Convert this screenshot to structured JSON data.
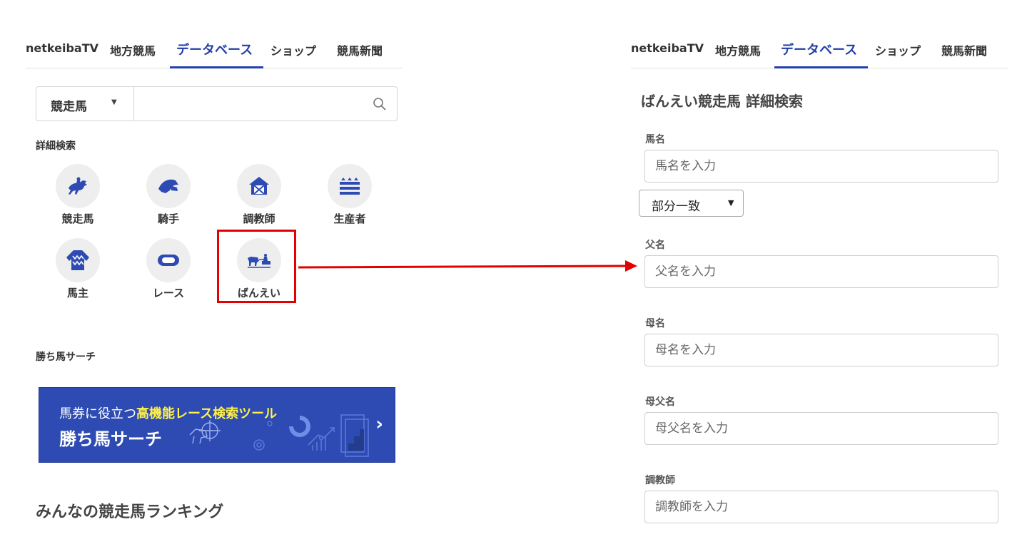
{
  "nav": {
    "tabs": [
      "netkeibaTV",
      "地方競馬",
      "データベース",
      "ショップ",
      "競馬新聞"
    ],
    "active": "データベース"
  },
  "search": {
    "category": "競走馬",
    "placeholder": ""
  },
  "detail_search": {
    "label": "詳細検索",
    "categories": [
      "競走馬",
      "騎手",
      "調教師",
      "生産者",
      "馬主",
      "レース",
      "ばんえい"
    ]
  },
  "kachiuma": {
    "label": "勝ち馬サーチ",
    "banner_line1_prefix": "馬券に役立つ",
    "banner_line1_highlight": "高機能レース検索ツール",
    "banner_line2": "勝ち馬サーチ"
  },
  "ranking_title": "みんなの競走馬ランキング",
  "colors": {
    "accent": "#2340a8",
    "highlight": "#e20000",
    "banner": "#2d4bb2",
    "banner_highlight": "#fff04a"
  },
  "banei_form": {
    "title": "ばんえい競走馬 詳細検索",
    "match_mode": "部分一致",
    "fields": [
      {
        "label": "馬名",
        "placeholder": "馬名を入力"
      },
      {
        "label": "父名",
        "placeholder": "父名を入力"
      },
      {
        "label": "母名",
        "placeholder": "母名を入力"
      },
      {
        "label": "母父名",
        "placeholder": "母父名を入力"
      },
      {
        "label": "調教師",
        "placeholder": "調教師を入力"
      }
    ]
  }
}
